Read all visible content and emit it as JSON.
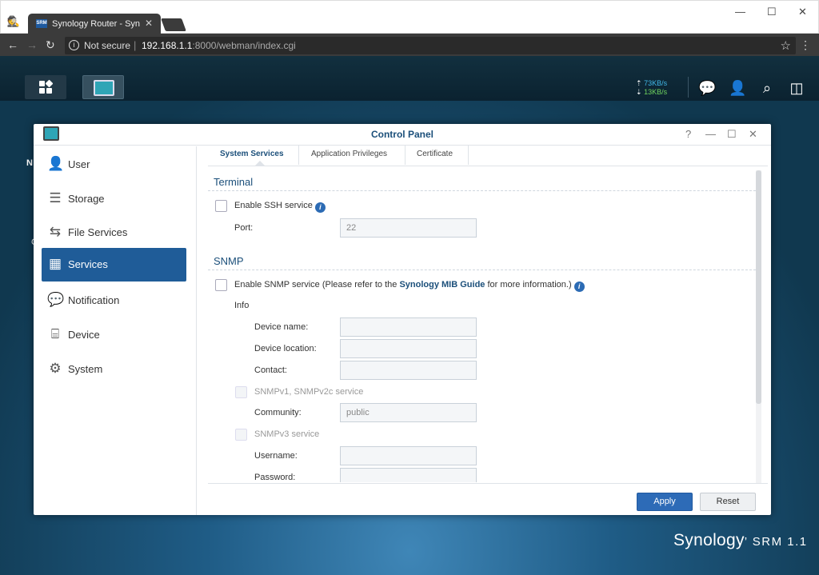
{
  "browser": {
    "tab_title": "Synology Router - Synology",
    "tab_favicon": "SRM",
    "security": "Not secure",
    "url_host": "192.168.1.1",
    "url_path": ":8000/webman/index.cgi"
  },
  "taskbar": {
    "upload_speed": "73KB/s",
    "download_speed": "13KB/s"
  },
  "desktop": {
    "partial_label_1": "N",
    "partial_label_2": "C",
    "brand_name": "Synology",
    "brand_product": "SRM",
    "brand_version": "1.1"
  },
  "window": {
    "title": "Control Panel"
  },
  "sidebar": {
    "items": [
      {
        "label": "User"
      },
      {
        "label": "Storage"
      },
      {
        "label": "File Services"
      },
      {
        "label": "Services"
      },
      {
        "label": "Notification"
      },
      {
        "label": "Device"
      },
      {
        "label": "System"
      }
    ]
  },
  "tabs": [
    {
      "label": "System Services"
    },
    {
      "label": "Application Privileges"
    },
    {
      "label": "Certificate"
    }
  ],
  "terminal": {
    "title": "Terminal",
    "ssh_label": "Enable SSH service",
    "port_label": "Port:",
    "port_value": "22"
  },
  "snmp": {
    "title": "SNMP",
    "enable_prefix": "Enable SNMP service (Please refer to the ",
    "enable_link": "Synology MIB Guide",
    "enable_suffix": " for more information.)",
    "info_label": "Info",
    "device_name_label": "Device name:",
    "device_location_label": "Device location:",
    "contact_label": "Contact:",
    "v1v2_label": "SNMPv1, SNMPv2c service",
    "community_label": "Community:",
    "community_value": "public",
    "v3_label": "SNMPv3 service",
    "username_label": "Username:",
    "password_label": "Password:"
  },
  "footer": {
    "apply": "Apply",
    "reset": "Reset"
  },
  "colors": {
    "accent": "#1f5c98",
    "apply_button": "#2d6bb7",
    "link": "#1b4f7a"
  }
}
